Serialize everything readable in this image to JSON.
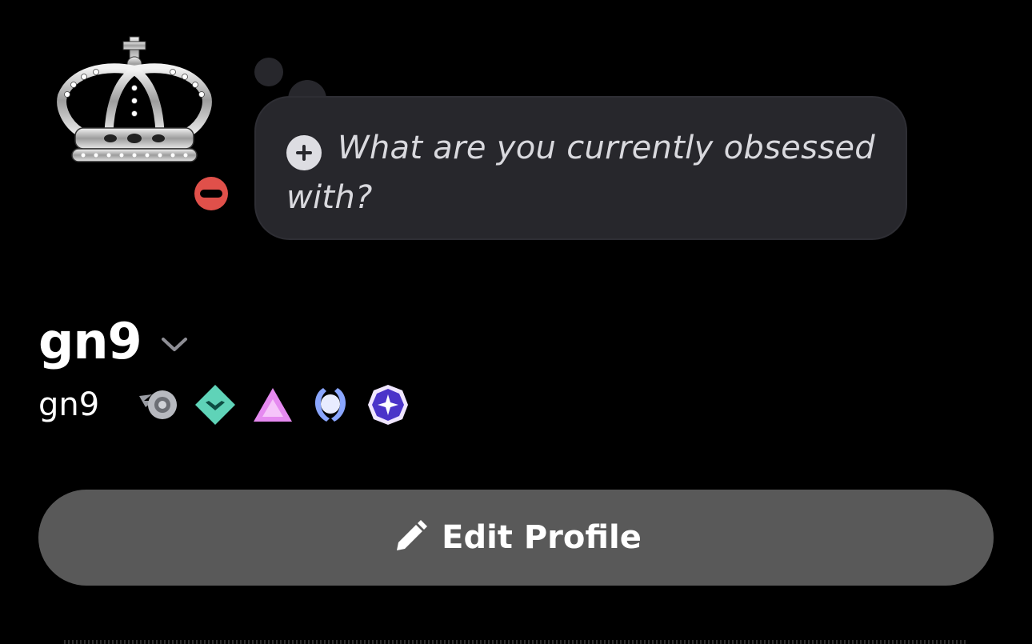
{
  "profile": {
    "avatar_icon": "crown-avatar",
    "status": "do-not-disturb",
    "status_color": "#e0504a",
    "display_name": "gn9",
    "handle": "gn9"
  },
  "thought_bubble": {
    "placeholder": "What are you currently obsessed with?",
    "add_icon": "plus-circle-icon"
  },
  "badges": [
    {
      "name": "hypesquad-style-badge",
      "color": "#9a9ca3"
    },
    {
      "name": "green-diamond-badge",
      "color": "#5fd3b8"
    },
    {
      "name": "pink-triangle-badge",
      "color": "#e58af0"
    },
    {
      "name": "laurel-badge",
      "color": "#8aa6ff"
    },
    {
      "name": "purple-star-badge",
      "color": "#6b5cf0"
    }
  ],
  "actions": {
    "edit_profile_label": "Edit Profile"
  },
  "colors": {
    "background": "#000000",
    "bubble": "#27272c",
    "button": "#595959"
  }
}
